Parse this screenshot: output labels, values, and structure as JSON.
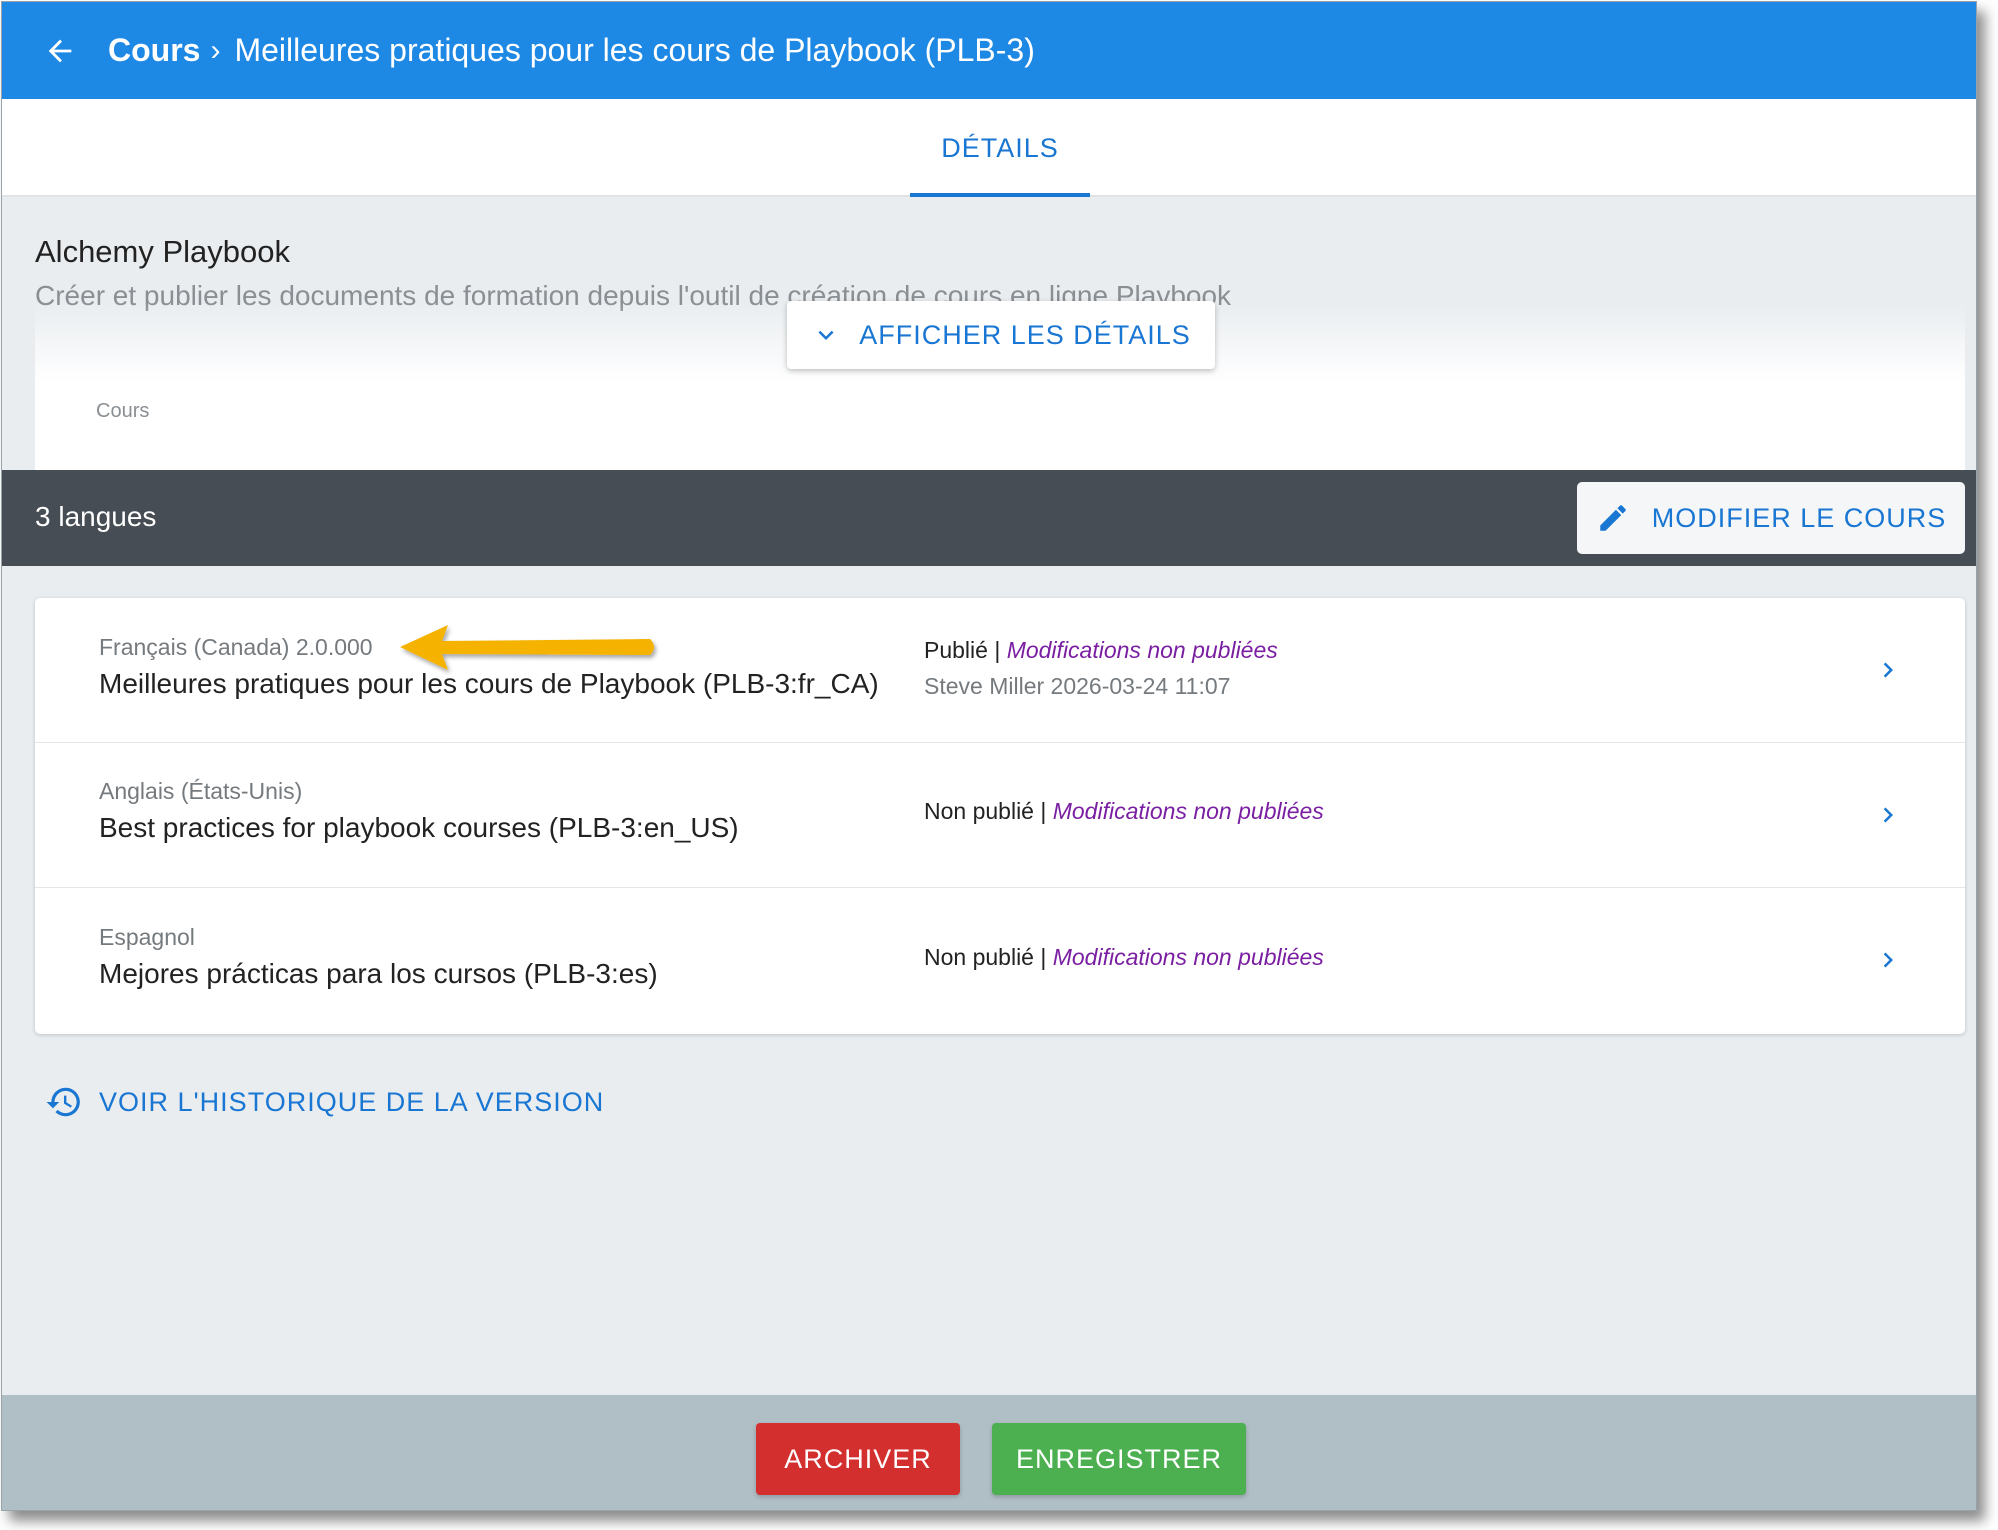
{
  "appbar": {
    "breadcrumb_root": "Cours",
    "breadcrumb_separator": "›",
    "title": "Meilleures pratiques pour les cours de Playbook (PLB-3)",
    "color": "#1e88e5"
  },
  "tabs": [
    {
      "label": "DÉTAILS",
      "active": true
    }
  ],
  "course": {
    "name": "Alchemy Playbook",
    "description": "Créer et publier les documents de formation depuis l'outil de création de cours en ligne Playbook",
    "show_details_label": "AFFICHER LES DÉTAILS",
    "type_label": "Cours"
  },
  "languages_bar": {
    "count_label": "3 langues",
    "edit_course_label": "MODIFIER LE COURS"
  },
  "languages": [
    {
      "meta": "Français (Canada) 2.0.000",
      "name": "Meilleures pratiques pour les cours de Playbook (PLB-3:fr_CA)",
      "status": "Publié",
      "separator": " | ",
      "modifications": "Modifications non publiées",
      "author_line": "Steve Miller 2026-03-24 11:07"
    },
    {
      "meta": "Anglais (États-Unis)",
      "name": "Best practices for playbook courses (PLB-3:en_US)",
      "status": "Non publié",
      "separator": " | ",
      "modifications": "Modifications non publiées"
    },
    {
      "meta": "Espagnol",
      "name": "Mejores prácticas para los cursos (PLB-3:es)",
      "status": "Non publié",
      "separator": " | ",
      "modifications": "Modifications non publiées"
    }
  ],
  "history_link_label": "VOIR L'HISTORIQUE DE LA VERSION",
  "actions": {
    "archive_label": "ARCHIVER",
    "save_label": "ENREGISTRER",
    "archive_color": "#d32f2f",
    "save_color": "#4caf50"
  },
  "colors": {
    "accent": "#1976d2",
    "modification_text": "#7b1fa2",
    "annotation_arrow": "#f5b300"
  }
}
